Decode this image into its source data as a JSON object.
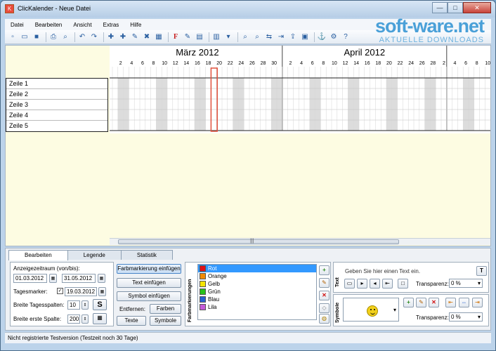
{
  "window": {
    "title": "ClicKalender - Neue Datei",
    "minimize_label": "—",
    "maximize_label": "□",
    "close_label": "✕"
  },
  "watermark": {
    "line1": "soft-ware.net",
    "line2": "AKTUELLE DOWNLOADS"
  },
  "menu": [
    "Datei",
    "Bearbeiten",
    "Ansicht",
    "Extras",
    "Hilfe"
  ],
  "toolbar_icons": [
    "new-icon",
    "open-icon",
    "save-icon",
    "print-icon",
    "print-preview-icon",
    "undo-icon",
    "redo-icon",
    "insert-row-icon",
    "insert-row-below-icon",
    "edit-row-icon",
    "delete-row-icon",
    "layout-icon",
    "font-color-icon",
    "edit-icon",
    "grid-icon",
    "columns-icon",
    "format-icon",
    "find-icon",
    "find-next-icon",
    "move-icon",
    "move-right-icon",
    "export-icon",
    "image-icon",
    "anchor-icon",
    "settings-icon",
    "help-icon"
  ],
  "toolbar_glyphs": [
    "▫",
    "▭",
    "■",
    "⎙",
    "⌕",
    "↶",
    "↷",
    "✚",
    "✚",
    "✎",
    "✖",
    "▦",
    "F",
    "✎",
    "▤",
    "▥",
    "▾",
    "⌕",
    "⌕",
    "⇆",
    "⇥",
    "⇪",
    "▣",
    "⚓",
    "⚙",
    "?"
  ],
  "months": [
    {
      "name": "März 2012"
    },
    {
      "name": "April 2012"
    }
  ],
  "tick_labels": [
    "2",
    "4",
    "6",
    "8",
    "10",
    "12",
    "14",
    "16",
    "18",
    "20",
    "22",
    "24",
    "26",
    "28",
    "30",
    "2",
    "4",
    "6",
    "8",
    "10",
    "12",
    "14",
    "16",
    "18",
    "20",
    "22",
    "24",
    "26",
    "28",
    "2",
    "4",
    "6",
    "8",
    "10"
  ],
  "rows": [
    "Zeile 1",
    "Zeile 2",
    "Zeile 3",
    "Zeile 4",
    "Zeile 5"
  ],
  "tabs": [
    "Bearbeiten",
    "Legende",
    "Statistik"
  ],
  "edit": {
    "range_label": "Anzeigezeitraum (von/bis):",
    "from_date": "01.03.2012",
    "to_date": "31.05.2012",
    "day_marker_label": "Tagesmarker:",
    "day_marker_checked": "✓",
    "day_marker_date": "19.03.2012",
    "day_width_label": "Breite Tagesspalten:",
    "day_width_value": "10",
    "first_col_label": "Breite erste Spalte:",
    "first_col_value": "200",
    "s_button": "S"
  },
  "actions": {
    "add_color": "Farbmarkierung einfügen",
    "add_text": "Text einfügen",
    "add_symbol": "Symbol einfügen",
    "remove_label": "Entfernen:",
    "remove_colors": "Farben",
    "remove_texts": "Texte",
    "remove_symbols": "Symbole"
  },
  "color_markers": {
    "title": "Farbmarkierungen",
    "items": [
      {
        "label": "Rot",
        "color": "#e0101a"
      },
      {
        "label": "Orange",
        "color": "#f28a00"
      },
      {
        "label": "Gelb",
        "color": "#f5e400"
      },
      {
        "label": "Grün",
        "color": "#27c21a"
      },
      {
        "label": "Blau",
        "color": "#2760d2"
      },
      {
        "label": "Lila",
        "color": "#c45ad8"
      }
    ]
  },
  "text_section": {
    "title": "Text",
    "placeholder": "Geben Sie hier einen Text ein.",
    "transparency_label": "Transparenz:",
    "transparency_value": "0 %"
  },
  "symbol_section": {
    "title": "Symbole",
    "transparency_label": "Transparenz:",
    "transparency_value": "0 %"
  },
  "status": "Nicht registrierte Testversion (Testzeit noch 30 Tage)"
}
